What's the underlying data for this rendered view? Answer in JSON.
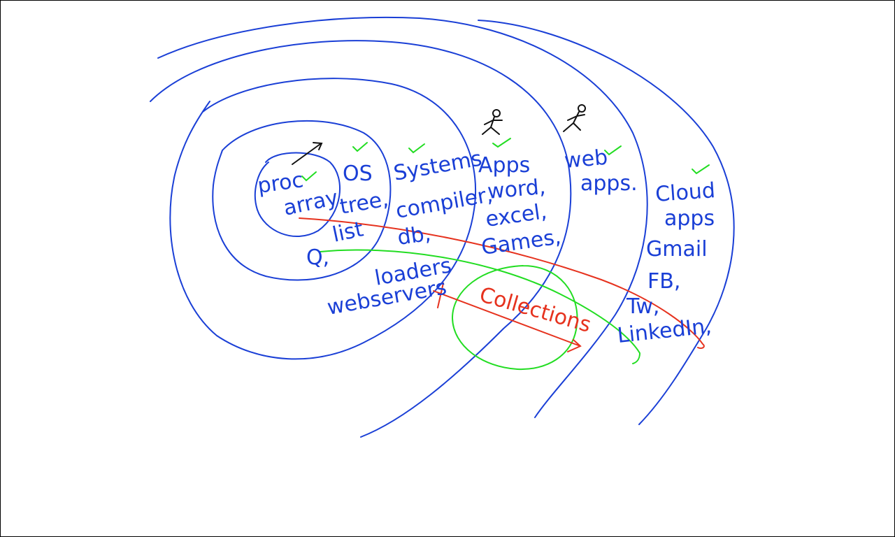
{
  "colors": {
    "layers": "#1a3fd6",
    "path": "#e6321e",
    "highlight": "#22dd22",
    "figures": "#111111"
  },
  "layers": {
    "proc": {
      "lines": [
        "proc",
        "array",
        "Q,"
      ]
    },
    "os": {
      "lines": [
        "OS",
        "tree,",
        "list"
      ]
    },
    "systems": {
      "lines": [
        "Systems",
        "compiler,",
        "db,",
        "loaders",
        "webservers"
      ]
    },
    "apps": {
      "lines": [
        "Apps",
        "word,",
        "excel,",
        "Games,"
      ]
    },
    "web": {
      "lines": [
        "web",
        "apps."
      ]
    },
    "cloud": {
      "lines": [
        "Cloud",
        "apps",
        "Gmail",
        "FB,",
        "Tw,",
        "LinkedIn,"
      ]
    }
  },
  "collections_label": "Collections",
  "icons": [
    "check-icon",
    "stick-figure-icon",
    "arrow-icon"
  ]
}
